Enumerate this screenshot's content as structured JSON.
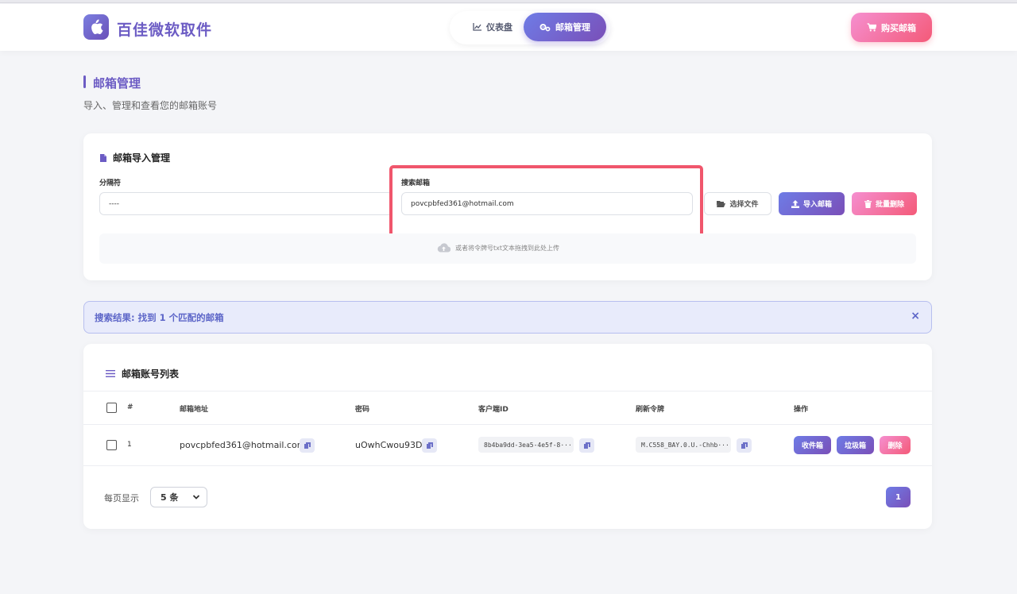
{
  "header": {
    "brand": "百佳微软取件",
    "nav": [
      {
        "label": "仪表盘"
      },
      {
        "label": "邮箱管理"
      }
    ],
    "buy_label": "购买邮箱"
  },
  "page": {
    "title": "邮箱管理",
    "subtitle": "导入、管理和查看您的邮箱账号"
  },
  "import_card": {
    "title": "邮箱导入管理",
    "separator_label": "分隔符",
    "separator_value": "----",
    "search_label": "搜索邮箱",
    "search_value": "povcpbfed361@hotmail.com",
    "choose_file_label": "选择文件",
    "import_label": "导入邮箱",
    "batch_delete_label": "批量删除",
    "drop_hint": "或者将令牌号txt文本拖拽到此处上传"
  },
  "search_result": {
    "text": "搜索结果: 找到 1 个匹配的邮箱",
    "close_icon": "×"
  },
  "list_card": {
    "title": "邮箱账号列表",
    "columns": [
      "#",
      "邮箱地址",
      "密码",
      "客户端ID",
      "刷新令牌",
      "操作"
    ],
    "rows": [
      {
        "index": "1",
        "email": "povcpbfed361@hotmail.com",
        "password": "uOwhCwou93D",
        "client_id": "8b4ba9dd-3ea5-4e5f-8···",
        "refresh_token": "M.C558_BAY.0.U.-Chhb···",
        "actions": {
          "inbox": "收件箱",
          "junk": "垃圾箱",
          "delete": "删除"
        }
      }
    ],
    "per_page_label": "每页显示",
    "per_page_value": "5 条",
    "current_page": "1"
  },
  "colors": {
    "accent": "#6c5cc4",
    "pink": "#f45a78",
    "highlight": "#f0566c"
  }
}
